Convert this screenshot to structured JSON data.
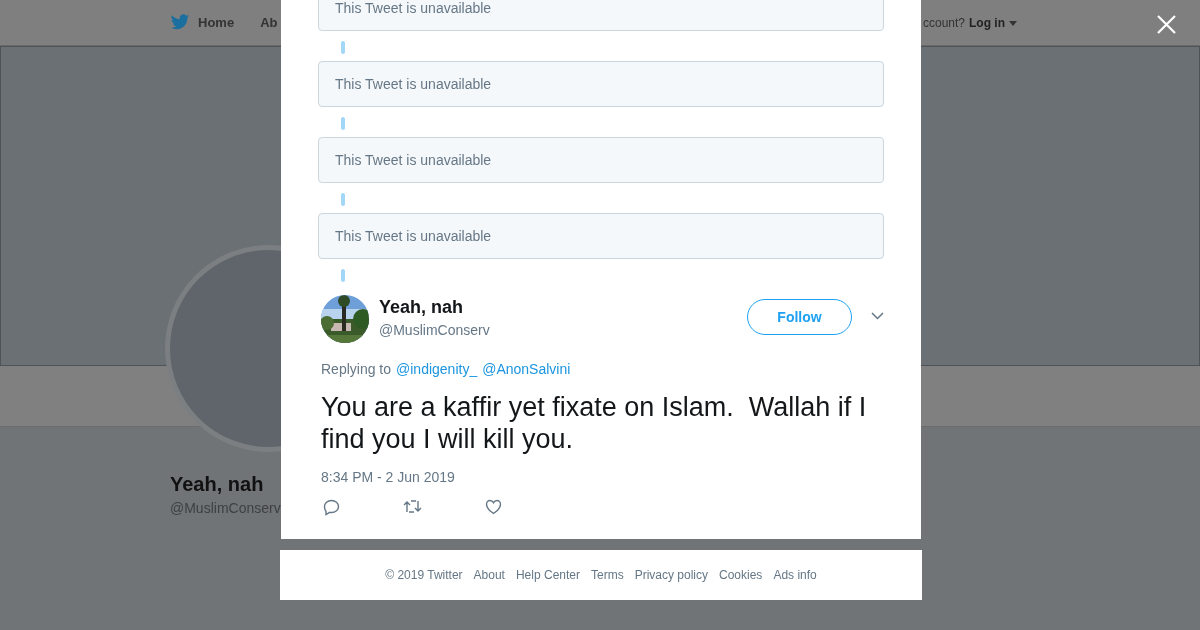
{
  "nav": {
    "items": [
      "Home",
      "Ab"
    ],
    "login_prompt": "ccount?",
    "login": "Log in"
  },
  "profile": {
    "name": "Yeah, nah",
    "handle": "@MuslimConserv"
  },
  "thread": {
    "unavailable": [
      "This Tweet is unavailable",
      "This Tweet is unavailable",
      "This Tweet is unavailable",
      "This Tweet is unavailable"
    ]
  },
  "tweet": {
    "name": "Yeah, nah",
    "handle": "@MuslimConserv",
    "follow": "Follow",
    "replying_label": "Replying to",
    "reply_to": [
      "@indigenity_",
      "@AnonSalvini"
    ],
    "text": "You are a kaffir yet fixate on Islam.  Wallah if I find you I will kill you.",
    "time": "8:34 PM - 2 Jun 2019"
  },
  "footer": {
    "copyright": "© 2019 Twitter",
    "links": [
      "About",
      "Help Center",
      "Terms",
      "Privacy policy",
      "Cookies",
      "Ads info"
    ]
  }
}
